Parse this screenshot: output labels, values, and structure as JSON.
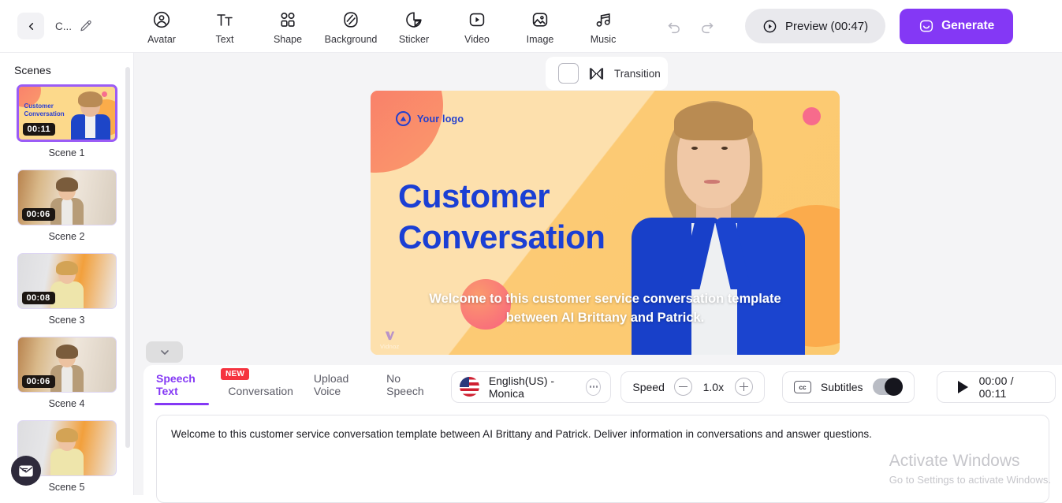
{
  "topbar": {
    "back_icon": "chevron-left-icon",
    "project_title": "C...",
    "edit_icon": "pencil-icon",
    "tools": [
      {
        "label": "Avatar",
        "icon": "avatar-icon"
      },
      {
        "label": "Text",
        "icon": "text-icon"
      },
      {
        "label": "Shape",
        "icon": "shape-icon"
      },
      {
        "label": "Background",
        "icon": "background-icon"
      },
      {
        "label": "Sticker",
        "icon": "sticker-icon"
      },
      {
        "label": "Video",
        "icon": "video-icon"
      },
      {
        "label": "Image",
        "icon": "image-icon"
      },
      {
        "label": "Music",
        "icon": "music-icon"
      }
    ],
    "undo_icon": "undo-icon",
    "redo_icon": "redo-icon",
    "preview_label": "Preview (00:47)",
    "preview_icon": "play-circle-icon",
    "generate_label": "Generate",
    "generate_icon": "smile-icon",
    "accent_color": "#8438f5"
  },
  "sidebar": {
    "title": "Scenes",
    "scenes": [
      {
        "label": "Scene 1",
        "duration": "00:11",
        "selected": true
      },
      {
        "label": "Scene 2",
        "duration": "00:06",
        "selected": false
      },
      {
        "label": "Scene 3",
        "duration": "00:08",
        "selected": false
      },
      {
        "label": "Scene 4",
        "duration": "00:06",
        "selected": false
      },
      {
        "label": "Scene 5",
        "duration": "",
        "selected": false
      }
    ],
    "chat_icon": "message-envelope-icon"
  },
  "transition": {
    "label": "Transition",
    "icon": "transition-bowtie-icon"
  },
  "canvas": {
    "logo_text": "Your logo",
    "title_line1": "Customer",
    "title_line2": "Conversation",
    "subtitle": "Welcome to this customer service conversation template between AI Brittany and Patrick.",
    "watermark": "Vidnoz",
    "title_color": "#1b3fd4",
    "bg_color": "#fcd89a"
  },
  "collapse": {
    "icon": "chevron-down-icon"
  },
  "bottom": {
    "tabs": [
      {
        "label": "Speech Text",
        "active": true
      },
      {
        "label": "Conversation",
        "active": false,
        "badge": "NEW"
      },
      {
        "label": "Upload Voice",
        "active": false
      },
      {
        "label": "No Speech",
        "active": false
      }
    ],
    "voice": {
      "flag": "us-flag-icon",
      "name": "English(US) - Monica",
      "more_icon": "ellipsis-icon"
    },
    "speed": {
      "label": "Speed",
      "value": "1.0x",
      "minus_icon": "minus-icon",
      "plus_icon": "plus-icon"
    },
    "subtitles": {
      "cc_label": "cc",
      "label": "Subtitles",
      "enabled": true
    },
    "player": {
      "play_icon": "play-icon",
      "time": "00:00 / 00:11"
    },
    "script_text": "Welcome to this customer service conversation template between AI Brittany and Patrick. Deliver information in conversations and answer questions."
  },
  "windows_watermark": {
    "line1": "Activate Windows",
    "line2": "Go to Settings to activate Windows."
  }
}
